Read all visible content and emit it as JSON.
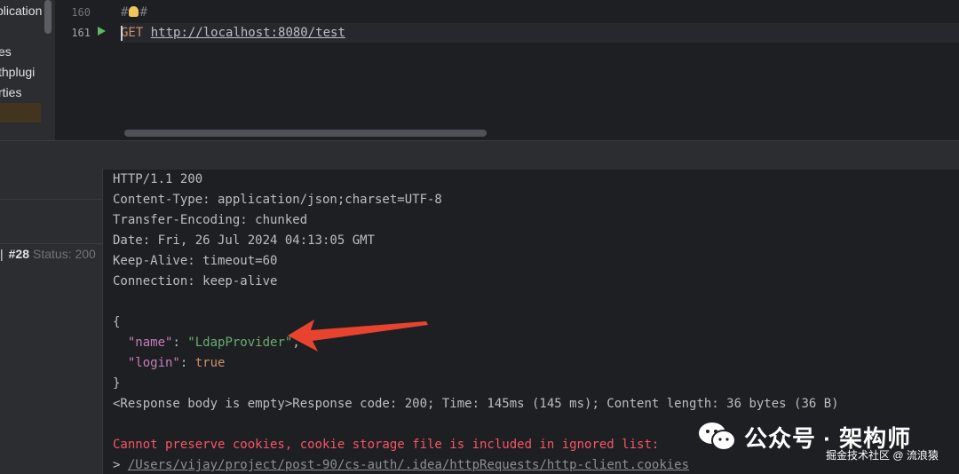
{
  "project_tree": {
    "items": [
      "plication",
      "es",
      "thplugi",
      "rties"
    ]
  },
  "editor": {
    "lines": [
      {
        "number": "160",
        "text": "#"
      },
      {
        "number": "161",
        "method": "GET",
        "url": "http://localhost:8080/test"
      }
    ]
  },
  "history": {
    "entry_separator": "|",
    "entry_number": "#28",
    "entry_status": "Status: 200"
  },
  "response": {
    "headers": [
      "HTTP/1.1 200",
      "Content-Type: application/json;charset=UTF-8",
      "Transfer-Encoding: chunked",
      "Date: Fri, 26 Jul 2024 04:13:05 GMT",
      "Keep-Alive: timeout=60",
      "Connection: keep-alive"
    ],
    "body": {
      "open_brace": "{",
      "name_key": "\"name\"",
      "name_value": "\"LdapProvider\"",
      "login_key": "\"login\"",
      "login_value": "true",
      "close_brace": "}"
    },
    "summary": "<Response body is empty>Response code: 200; Time: 145ms (145 ms); Content length: 36 bytes (36 B)",
    "cookie_error": "Cannot preserve cookies, cookie storage file is included in ignored list:",
    "cookie_prompt": ">",
    "cookie_path": "/Users/vijay/project/post-90/cs-auth/.idea/httpRequests/http-client.cookies"
  },
  "watermark": {
    "title": "公众号 · 架构师",
    "subtitle": "掘金技术社区 @ 流浪猿"
  },
  "colors": {
    "arrow": "#e8432f",
    "run_icon": "#5fb865",
    "json_string": "#6aab73",
    "json_key": "#c77dbb",
    "error": "#f75464"
  }
}
